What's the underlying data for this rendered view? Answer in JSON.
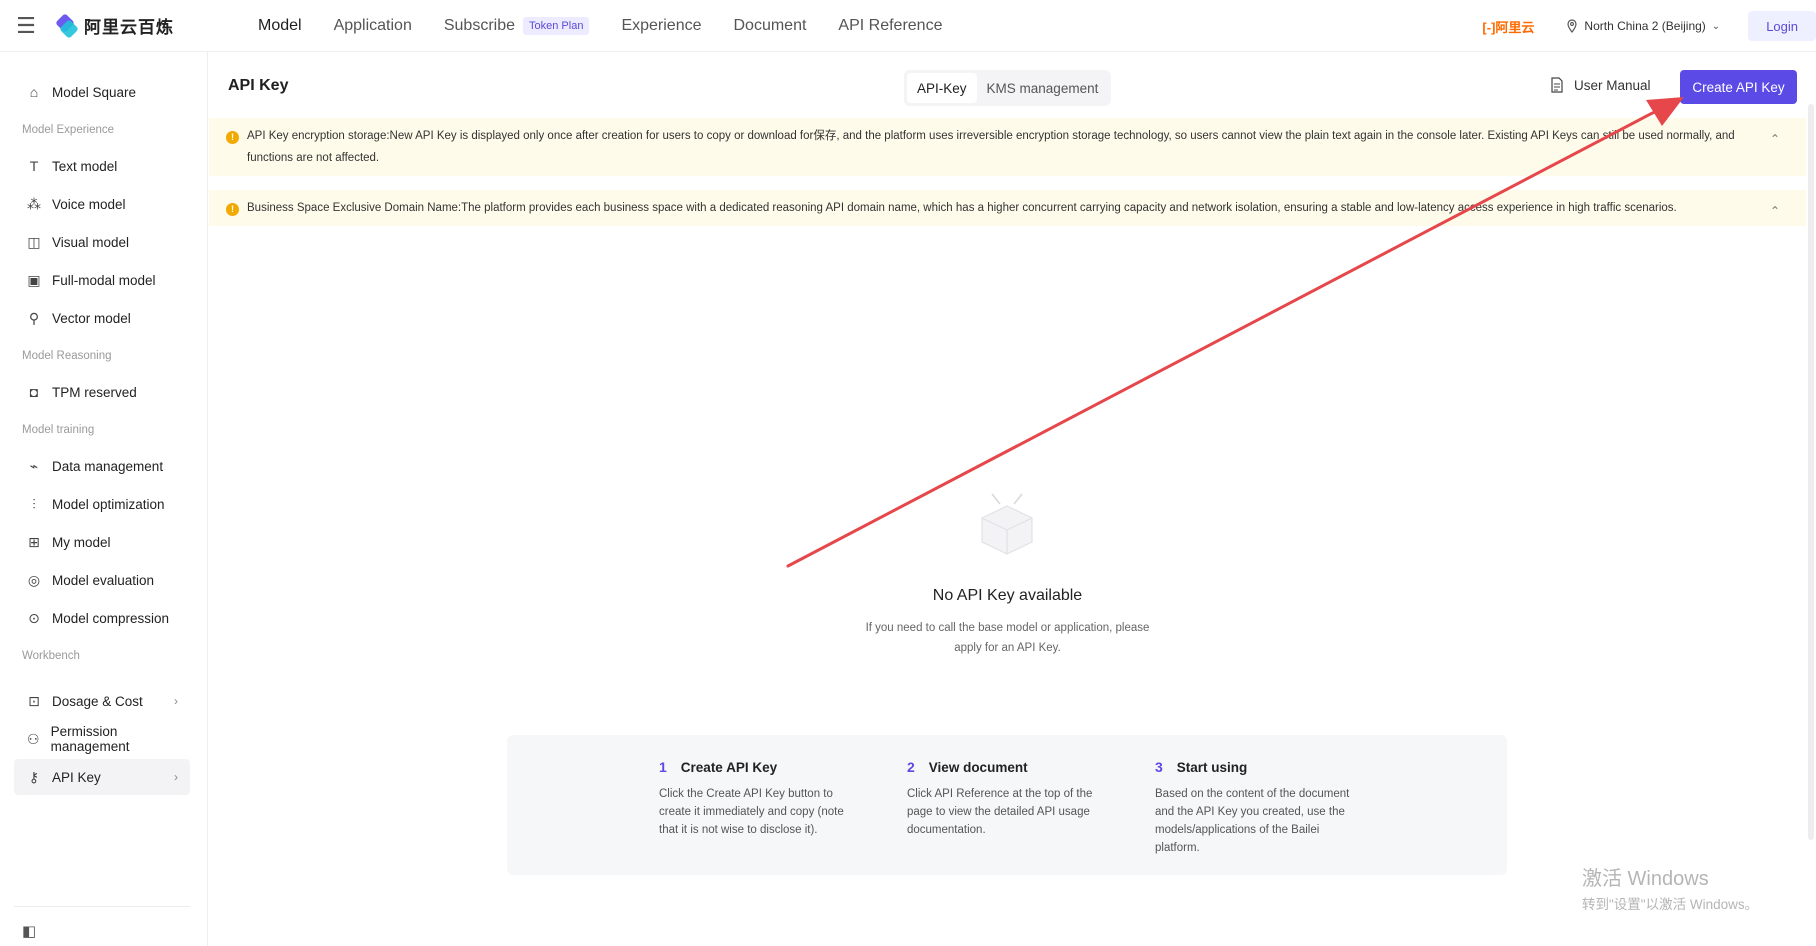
{
  "topbar": {
    "brand": "阿里云百炼",
    "nav": [
      {
        "label": "Model"
      },
      {
        "label": "Application"
      },
      {
        "label": "Subscribe",
        "badge": "Token Plan"
      },
      {
        "label": "Experience"
      },
      {
        "label": "Document"
      },
      {
        "label": "API Reference"
      }
    ],
    "aliyun": "[-]阿里云",
    "region": "North China 2 (Beijing)",
    "login": "Login"
  },
  "sidebar": {
    "model_square": "Model Square",
    "group_experience": "Model Experience",
    "text_model": "Text model",
    "voice_model": "Voice model",
    "visual_model": "Visual model",
    "full_modal_model": "Full-modal model",
    "vector_model": "Vector model",
    "group_reasoning": "Model Reasoning",
    "tpm_reserved": "TPM reserved",
    "group_training": "Model training",
    "data_management": "Data management",
    "model_optimization": "Model optimization",
    "my_model": "My model",
    "model_evaluation": "Model evaluation",
    "model_compression": "Model compression",
    "group_workbench": "Workbench",
    "dosage_cost": "Dosage & Cost",
    "permission_management": "Permission management",
    "api_key": "API Key"
  },
  "header": {
    "title": "API Key",
    "tabs": [
      "API-Key",
      "KMS management"
    ],
    "user_manual": "User Manual",
    "create_button": "Create API Key"
  },
  "notices": [
    "API Key encryption storage:New API Key is displayed only once after creation for users to copy or download for保存, and the platform uses irreversible encryption storage technology, so users cannot view the plain text again in the console later. Existing API Keys can still be used normally, and functions are not affected.",
    "Business Space Exclusive Domain Name:The platform provides each business space with a dedicated reasoning API domain name, which has a higher concurrent carrying capacity and network isolation, ensuring a stable and low-latency access experience in high traffic scenarios."
  ],
  "empty": {
    "title": "No API Key available",
    "desc": "If you need to call the base model or application, please apply for an API Key."
  },
  "steps": [
    {
      "num": "1",
      "title": "Create API Key",
      "text": "Click the Create API Key button to create it immediately and copy (note that it is not wise to disclose it)."
    },
    {
      "num": "2",
      "title": "View document",
      "text": "Click API Reference at the top of the page to view the detailed API usage documentation."
    },
    {
      "num": "3",
      "title": "Start using",
      "text": "Based on the content of the document and the API Key you created, use the models/applications of the Bailei platform."
    }
  ],
  "watermark": {
    "line1": "激活 Windows",
    "line2": "转到\"设置\"以激活 Windows。"
  },
  "colors": {
    "accent": "#5b4ae6",
    "notice_bg": "#fffbea",
    "warning": "#f2a900",
    "annotation_arrow": "#e5474b",
    "aliyun_orange": "#ff6a00"
  }
}
